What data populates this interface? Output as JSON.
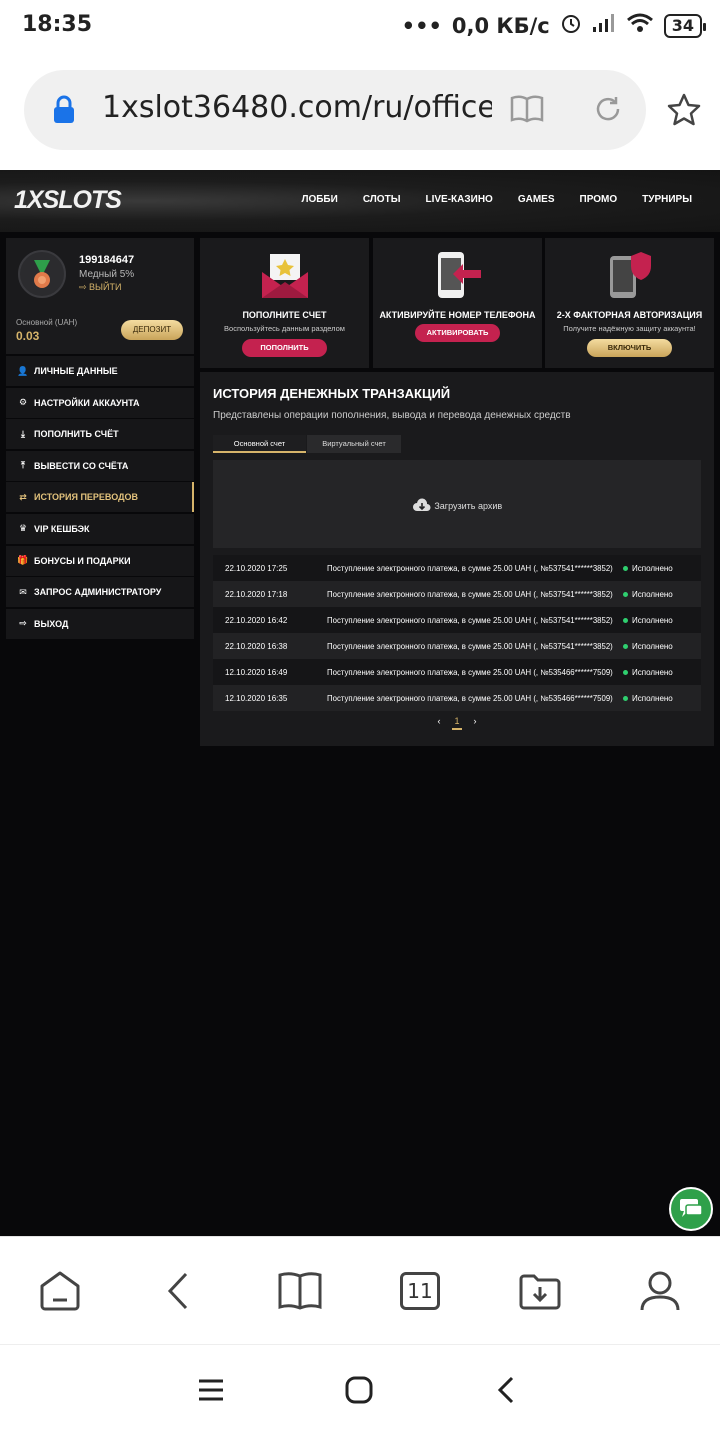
{
  "status_bar": {
    "time": "18:35",
    "net_speed": "0,0 КБ/с",
    "battery": "34",
    "icons": [
      "dots-icon",
      "alarm-icon",
      "signal-icon",
      "wifi-icon",
      "battery-icon"
    ]
  },
  "browser": {
    "url": "1xslot36480.com/ru/office",
    "tab_count": "11",
    "bottom_icons": [
      "home-icon",
      "back-icon",
      "bookmarks-icon",
      "tabs-icon",
      "downloads-icon",
      "profile-icon"
    ]
  },
  "site": {
    "logo": "1XSLOTS",
    "nav": [
      "ЛОББИ",
      "СЛОТЫ",
      "LIVE-КАЗИНО",
      "GAMES",
      "ПРОМО",
      "ТУРНИРЫ"
    ],
    "profile": {
      "user_id": "199184647",
      "level": "Медный 5%",
      "logout": "ВЫЙТИ",
      "balance_label": "Основной (UAH)",
      "balance": "0.03",
      "deposit_button": "ДЕПОЗИТ"
    },
    "menu": [
      {
        "label": "ЛИЧНЫЕ ДАННЫЕ",
        "icon": "user-plus-icon"
      },
      {
        "label": "НАСТРОЙКИ АККАУНТА",
        "icon": "gears-icon"
      },
      {
        "label": "ПОПОЛНИТЬ СЧЁТ",
        "icon": "download-icon"
      },
      {
        "label": "ВЫВЕСТИ СО СЧЁТА",
        "icon": "upload-icon"
      },
      {
        "label": "ИСТОРИЯ ПЕРЕВОДОВ",
        "icon": "transfer-icon",
        "active": true
      },
      {
        "label": "VIP КЕШБЭК",
        "icon": "crown-icon"
      },
      {
        "label": "БОНУСЫ И ПОДАРКИ",
        "icon": "gift-icon"
      },
      {
        "label": "ЗАПРОС АДМИНИСТРАТОРУ",
        "icon": "mail-icon"
      },
      {
        "label": "ВЫХОД",
        "icon": "exit-icon"
      }
    ],
    "cards": [
      {
        "title": "ПОПОЛНИТЕ СЧЕТ",
        "subtitle": "Воспользуйтесь данным разделом",
        "button": "ПОПОЛНИТЬ"
      },
      {
        "title": "АКТИВИРУЙТЕ НОМЕР ТЕЛЕФОНА",
        "subtitle": "",
        "button": "АКТИВИРОВАТЬ"
      },
      {
        "title": "2-Х ФАКТОРНАЯ АВТОРИЗАЦИЯ",
        "subtitle": "Получите надёжную защиту аккаунта!",
        "button": "ВКЛЮЧИТЬ"
      }
    ],
    "history": {
      "title": "ИСТОРИЯ ДЕНЕЖНЫХ ТРАНЗАКЦИЙ",
      "description": "Представлены операции пополнения, вывода и перевода денежных средств",
      "tabs": [
        "Основной счет",
        "Виртуальный счет"
      ],
      "archive_label": "Загрузить архив",
      "rows": [
        {
          "date": "22.10.2020 17:25",
          "desc": "Поступление электронного платежа, в сумме 25.00 UAH (, №537541******3852)",
          "status": "Исполнено"
        },
        {
          "date": "22.10.2020 17:18",
          "desc": "Поступление электронного платежа, в сумме 25.00 UAH (, №537541******3852)",
          "status": "Исполнено"
        },
        {
          "date": "22.10.2020 16:42",
          "desc": "Поступление электронного платежа, в сумме 25.00 UAH (, №537541******3852)",
          "status": "Исполнено"
        },
        {
          "date": "22.10.2020 16:38",
          "desc": "Поступление электронного платежа, в сумме 25.00 UAH (, №537541******3852)",
          "status": "Исполнено"
        },
        {
          "date": "12.10.2020 16:49",
          "desc": "Поступление электронного платежа, в сумме 25.00 UAH (, №535466******7509)",
          "status": "Исполнено"
        },
        {
          "date": "12.10.2020 16:35",
          "desc": "Поступление электронного платежа, в сумме 25.00 UAH (, №535466******7509)",
          "status": "Исполнено"
        }
      ],
      "pager": {
        "prev": "‹",
        "current": "1",
        "next": "›"
      }
    }
  },
  "colors": {
    "accent_gold": "#d6b46a",
    "button_red": "#c4224f",
    "status_green": "#2fcf6f",
    "chat_green": "#2fa04a"
  }
}
